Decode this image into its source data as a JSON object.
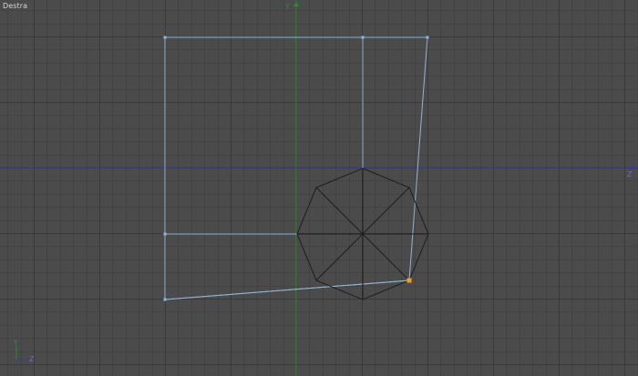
{
  "viewport": {
    "title": "Destra",
    "axis_labels": {
      "vertical": "Y",
      "horizontal": "Z"
    },
    "gizmo_labels": {
      "vertical": "Y",
      "horizontal": "Z"
    },
    "colors": {
      "background": "#4b4b4b",
      "grid_minor": "#434343",
      "grid_major": "#3a3a3a",
      "axis_vertical": "#2e8b2e",
      "axis_horizontal": "#3b3b9a",
      "spline": "#93b4d4",
      "mesh": "#1e1e1e",
      "selected_point": "#f0a020"
    }
  }
}
